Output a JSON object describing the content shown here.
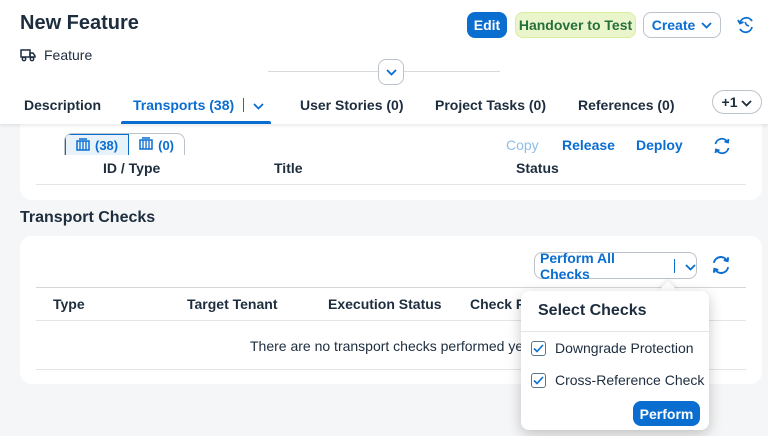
{
  "header": {
    "title": "New Feature",
    "subtitle": "Feature",
    "edit_label": "Edit",
    "handover_label": "Handover to Test",
    "create_label": "Create"
  },
  "tabs": [
    {
      "label": "Description"
    },
    {
      "label": "Transports (38)"
    },
    {
      "label": "User Stories (0)"
    },
    {
      "label": "Project Tasks (0)"
    },
    {
      "label": "References (0)"
    }
  ],
  "tab_more_label": "+1",
  "transports": {
    "segments": [
      {
        "count": "(38)",
        "icon": "transport-icon"
      },
      {
        "count": "(0)",
        "icon": "transport-icon"
      }
    ],
    "toolbar": {
      "copy": "Copy",
      "release": "Release",
      "deploy": "Deploy"
    },
    "columns": [
      "ID / Type",
      "Title",
      "Status"
    ]
  },
  "transport_checks": {
    "title": "Transport Checks",
    "perform_all_label": "Perform All Checks",
    "columns": [
      "Type",
      "Target Tenant",
      "Execution Status",
      "Check R"
    ],
    "no_data_text": "There are no transport checks performed ye"
  },
  "popover": {
    "title": "Select Checks",
    "items": [
      {
        "label": "Downgrade Protection",
        "checked": true
      },
      {
        "label": "Cross-Reference Check",
        "checked": true
      }
    ],
    "perform_label": "Perform"
  },
  "colors": {
    "brand": "#0a6ed1",
    "handover_bg": "#ebf5cb",
    "handover_text": "#256f3a"
  }
}
